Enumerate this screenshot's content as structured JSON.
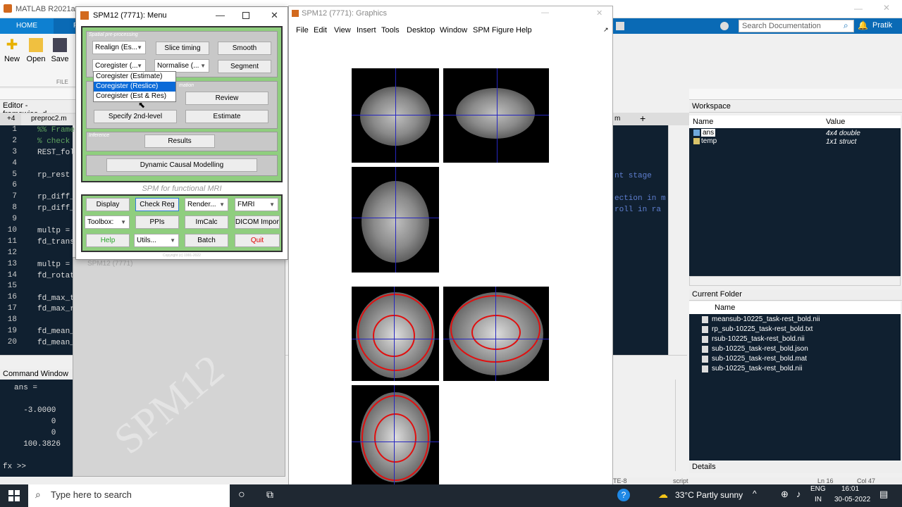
{
  "matlab": {
    "title": "MATLAB R2021a -",
    "home_tab": "HOME",
    "plots_tab": "P",
    "ribbon": {
      "new": "New",
      "open": "Open",
      "save": "Save",
      "file_section": "FILE"
    },
    "search_placeholder": "Search Documentation",
    "user": "Pratik",
    "editor_title": "Editor - framewise_d",
    "editor_tab": "preproc2.m",
    "editor_tab_prefix": "+4",
    "line_numbers": [
      "1",
      "2",
      "3",
      "4",
      "5",
      "6",
      "7",
      "8",
      "9",
      "10",
      "11",
      "12",
      "13",
      "14",
      "15",
      "16",
      "17",
      "18",
      "19",
      "20"
    ],
    "code_lines": [
      "%% Frame",
      "% check",
      "REST_fol",
      "",
      "rp_rest",
      "",
      "rp_diff_",
      "rp_diff_",
      "",
      "multp =",
      "fd_trans",
      "",
      "multp =",
      "fd_rotat",
      "",
      "fd_max_t",
      "fd_max_r",
      "",
      "fd_mean_",
      "fd_mean_"
    ],
    "code_right": {
      "l6": "nt stage",
      "l8": "ection in m",
      "l9": "roll in ra"
    },
    "right_tab": "m",
    "command_window": "Command Window",
    "cmd_lines": [
      "ans =",
      "",
      "  -3.0000",
      "        0",
      "        0",
      "  100.3826"
    ],
    "prompt": "fx >>",
    "workspace": {
      "title": "Workspace",
      "col_name": "Name",
      "col_value": "Value",
      "rows": [
        {
          "name": "ans",
          "value": "4x4 double"
        },
        {
          "name": "temp",
          "value": "1x1 struct"
        }
      ]
    },
    "current_folder": {
      "title": "Current Folder",
      "col_name": "Name",
      "files": [
        "meansub-10225_task-rest_bold.nii",
        "rp_sub-10225_task-rest_bold.txt",
        "rsub-10225_task-rest_bold.nii",
        "sub-10225_task-rest_bold.json",
        "sub-10225_task-rest_bold.mat",
        "sub-10225_task-rest_bold.nii"
      ]
    },
    "details": "Details",
    "status": {
      "left": "TE-8",
      "mid": "script",
      "ln": "Ln 16",
      "col": "Col 47"
    }
  },
  "spm_menu": {
    "title": "SPM12 (7771): Menu",
    "spatial_label": "Spatial pre-processing",
    "realign": "Realign (Es...",
    "slice_timing": "Slice timing",
    "smooth": "Smooth",
    "coregister": "Coregister (...",
    "normalise": "Normalise (...",
    "segment": "Segment",
    "dropdown_options": [
      "Coregister (Estimate)",
      "Coregister (Reslice)",
      "Coregister (Est & Res)"
    ],
    "model_label": "mation",
    "review": "Review",
    "specify_2nd": "Specify 2nd-level",
    "estimate": "Estimate",
    "inference_label": "Inference",
    "results": "Results",
    "dcm": "Dynamic Causal Modelling",
    "spm_fmri": "SPM for functional MRI",
    "display": "Display",
    "check_reg": "Check Reg",
    "render": "Render...",
    "fmri": "FMRI",
    "toolbox": "Toolbox:",
    "ppis": "PPIs",
    "imcalc": "ImCalc",
    "dicom": "DICOM Import",
    "help": "Help",
    "utils": "Utils...",
    "batch": "Batch",
    "quit": "Quit",
    "copyright": "Copyright (c) 1991-2022"
  },
  "spm_w3": {
    "title": "SPM12 (7771)",
    "watermark": "SPM12"
  },
  "graphics": {
    "title": "SPM12 (7771): Graphics",
    "menu": [
      "File",
      "Edit",
      "View",
      "Insert",
      "Tools",
      "Desktop",
      "Window",
      "SPM Figure",
      "Help"
    ]
  },
  "taskbar": {
    "search": "Type here to search",
    "weather": "33°C  Partly sunny",
    "lang1": "ENG",
    "lang2": "IN",
    "time": "16:01",
    "date": "30-05-2022"
  },
  "colors": {
    "spm_green": "#8fce7e",
    "matlab_blue": "#0a6ab5",
    "highlight": "#0a6ad8",
    "quit_red": "#e00000",
    "help_green": "#2aa52a"
  }
}
